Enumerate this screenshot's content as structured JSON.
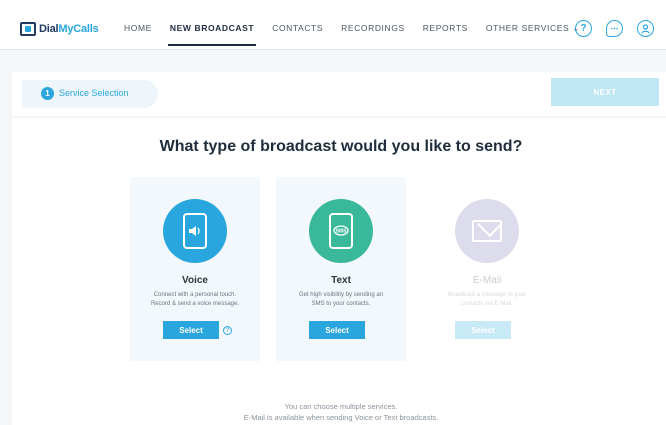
{
  "logo": {
    "part1": "Dial",
    "part2": "MyCalls"
  },
  "nav": {
    "items": [
      "HOME",
      "NEW BROADCAST",
      "CONTACTS",
      "RECORDINGS",
      "REPORTS",
      "OTHER SERVICES ⌄"
    ],
    "active_index": 1
  },
  "nav_icons": {
    "help": "?",
    "chat": "",
    "account": ""
  },
  "progress": {
    "step_number": "1",
    "step_label": "Service Selection",
    "next_label": "NEXT"
  },
  "question": "What type of broadcast would you like to send?",
  "cards": [
    {
      "title": "Voice",
      "desc_line1": "Connect with a personal touch.",
      "desc_line2": "Record & send a voice message.",
      "button": "Select",
      "icon": "phone-speaker-icon",
      "color": "#2aa6de",
      "enabled": true
    },
    {
      "title": "Text",
      "desc_line1": "Get high visibility by sending an",
      "desc_line2": "SMS to your contacts.",
      "button": "Select",
      "icon": "phone-sms-icon",
      "color": "#3ab89a",
      "enabled": true
    },
    {
      "title": "E-Mail",
      "desc_line1": "Broadcast a message to your",
      "desc_line2": "contacts via E-Mail.",
      "button": "Select",
      "icon": "envelope-icon",
      "color": "#dcdcec",
      "enabled": false
    }
  ],
  "footnote": {
    "line1": "You can choose multiple services.",
    "line2": "E-Mail is available when sending Voice or Text broadcasts."
  },
  "colors": {
    "accent": "#2aa6de",
    "text_green": "#3ab89a",
    "dark": "#1f2d3d"
  }
}
